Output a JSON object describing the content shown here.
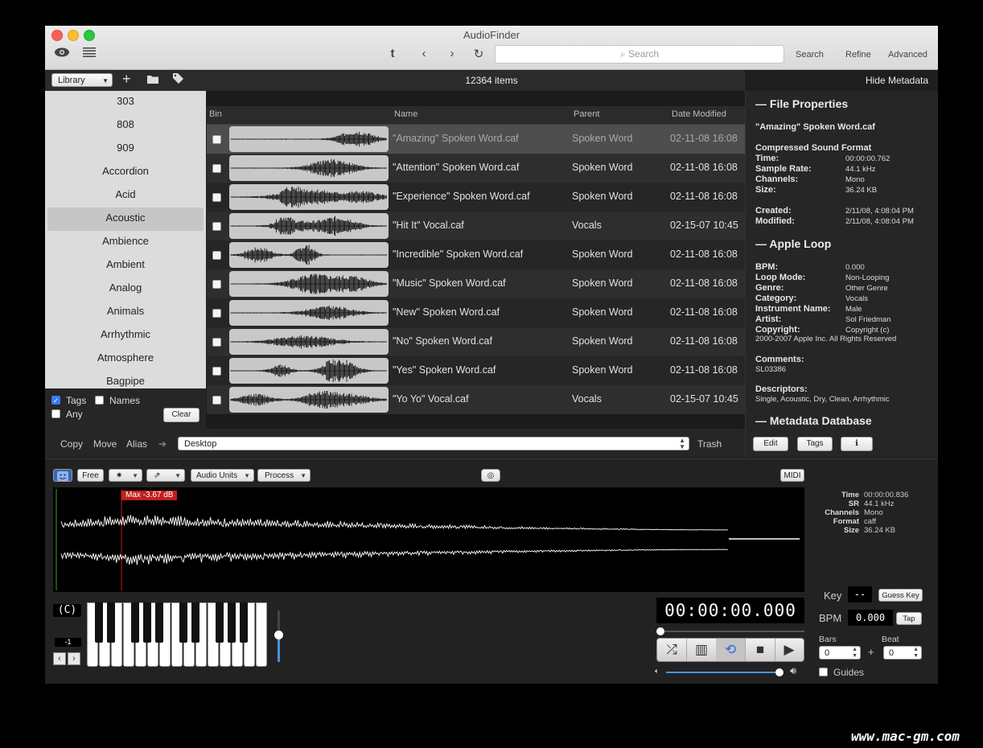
{
  "window": {
    "title": "AudioFinder"
  },
  "toolbar": {
    "search_placeholder": "Search",
    "search_label": "Search",
    "refine_label": "Refine",
    "advanced_label": "Advanced"
  },
  "library": {
    "selector": "Library",
    "item_count": "12364 items",
    "hide_metadata": "Hide Metadata",
    "tags": [
      "303",
      "808",
      "909",
      "Accordion",
      "Acid",
      "Acoustic",
      "Ambience",
      "Ambient",
      "Analog",
      "Animals",
      "Arrhythmic",
      "Atmosphere",
      "Bagpipe"
    ],
    "selected_tag": "Acoustic",
    "opt_tags": "Tags",
    "opt_names": "Names",
    "opt_any": "Any",
    "clear_label": "Clear"
  },
  "table": {
    "columns": {
      "bin": "Bin",
      "name": "Name",
      "parent": "Parent",
      "date": "Date Modified"
    },
    "rows": [
      {
        "name": "\"Amazing\" Spoken Word.caf",
        "parent": "Spoken Word",
        "date": "02-11-08 16:08"
      },
      {
        "name": "\"Attention\" Spoken Word.caf",
        "parent": "Spoken Word",
        "date": "02-11-08 16:08"
      },
      {
        "name": "\"Experience\" Spoken Word.caf",
        "parent": "Spoken Word",
        "date": "02-11-08 16:08"
      },
      {
        "name": "\"Hit It\" Vocal.caf",
        "parent": "Vocals",
        "date": "02-15-07 10:45"
      },
      {
        "name": "\"Incredible\" Spoken Word.caf",
        "parent": "Spoken Word",
        "date": "02-11-08 16:08"
      },
      {
        "name": "\"Music\" Spoken Word.caf",
        "parent": "Spoken Word",
        "date": "02-11-08 16:08"
      },
      {
        "name": "\"New\" Spoken Word.caf",
        "parent": "Spoken Word",
        "date": "02-11-08 16:08"
      },
      {
        "name": "\"No\" Spoken Word.caf",
        "parent": "Spoken Word",
        "date": "02-11-08 16:08"
      },
      {
        "name": "\"Yes\" Spoken Word.caf",
        "parent": "Spoken Word",
        "date": "02-11-08 16:08"
      },
      {
        "name": "\"Yo Yo\" Vocal.caf",
        "parent": "Vocals",
        "date": "02-15-07 10:45"
      }
    ]
  },
  "fileops": {
    "copy": "Copy",
    "move": "Move",
    "alias": "Alias",
    "destination": "Desktop",
    "trash": "Trash"
  },
  "metadata": {
    "file_properties_header": "— File Properties",
    "filename": "\"Amazing\" Spoken Word.caf",
    "format": "Compressed Sound Format",
    "time_k": "Time:",
    "time_v": "00:00:00.762",
    "sr_k": "Sample Rate:",
    "sr_v": "44.1 kHz",
    "ch_k": "Channels:",
    "ch_v": "Mono",
    "size_k": "Size:",
    "size_v": "36.24 KB",
    "created_k": "Created:",
    "created_v": "2/11/08, 4:08:04 PM",
    "modified_k": "Modified:",
    "modified_v": "2/11/08, 4:08:04 PM",
    "apple_loop_header": "— Apple Loop",
    "bpm_k": "BPM:",
    "bpm_v": "0.000",
    "loop_k": "Loop Mode:",
    "loop_v": "Non-Looping",
    "genre_k": "Genre:",
    "genre_v": "Other Genre",
    "cat_k": "Category:",
    "cat_v": "Vocals",
    "inst_k": "Instrument Name:",
    "inst_v": "Male",
    "artist_k": "Artist:",
    "artist_v": "Sol Friedman",
    "copy_k": "Copyright:",
    "copy_v": "Copyright (c)",
    "copy_v2": "2000-2007 Apple Inc.  All Rights Reserved",
    "comments_k": "Comments:",
    "comments_v": "SL03386",
    "desc_k": "Descriptors:",
    "desc_v": "Single, Acoustic, Dry, Clean, Arrhythmic",
    "db_header": "— Metadata Database",
    "edit_label": "Edit",
    "tags_label": "Tags",
    "info_icon": "ℹ"
  },
  "player": {
    "free_label": "Free",
    "audio_units_label": "Audio Units",
    "process_label": "Process",
    "midi_label": "MIDI",
    "max_label": "Max -3.67 dB",
    "info": [
      {
        "k": "Time",
        "v": "00:00:00.836"
      },
      {
        "k": "SR",
        "v": "44.1 kHz"
      },
      {
        "k": "Channels",
        "v": "Mono"
      },
      {
        "k": "Format",
        "v": "caff"
      },
      {
        "k": "Size",
        "v": "36.24 KB"
      }
    ],
    "key_note": "(C)",
    "octave": "-1",
    "time_display": "00:00:00.000",
    "key_label": "Key",
    "key_value": "--",
    "guess_key_label": "Guess Key",
    "bpm_label": "BPM",
    "bpm_value": "0.000",
    "tap_label": "Tap",
    "bars_label": "Bars",
    "beat_label": "Beat",
    "bars_value": "0",
    "beat_value": "0",
    "plus": "+",
    "guides_label": "Guides"
  },
  "watermark": "www.mac-gm.com"
}
